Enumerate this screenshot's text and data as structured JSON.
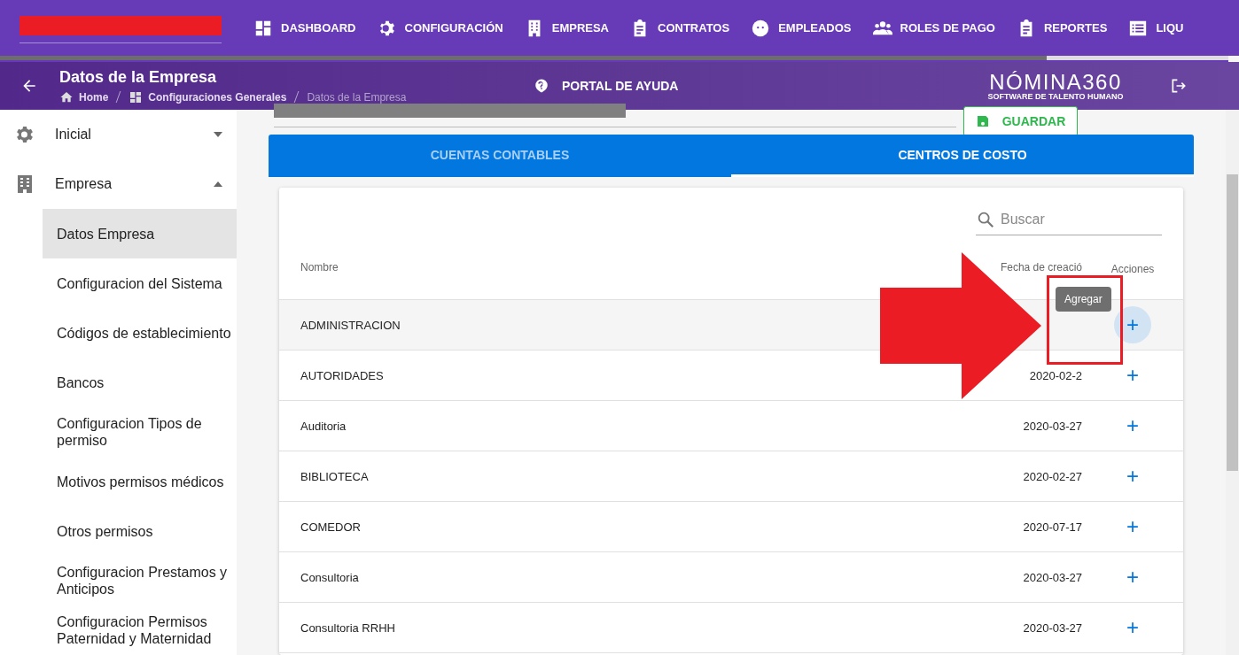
{
  "top_nav": {
    "items": [
      {
        "label": "DASHBOARD",
        "kind": "dashboard"
      },
      {
        "label": "CONFIGURACIÓN",
        "kind": "gear"
      },
      {
        "label": "EMPRESA",
        "kind": "building"
      },
      {
        "label": "CONTRATOS",
        "kind": "clipboard"
      },
      {
        "label": "EMPLEADOS",
        "kind": "face"
      },
      {
        "label": "ROLES DE PAGO",
        "kind": "people"
      },
      {
        "label": "REPORTES",
        "kind": "clipboard"
      },
      {
        "label": "LIQU",
        "kind": "list"
      }
    ]
  },
  "header": {
    "title": "Datos de la Empresa",
    "breadcrumbs": [
      "Home",
      "Configuraciones Generales",
      "Datos de la Empresa"
    ],
    "help": "PORTAL DE AYUDA",
    "logo": {
      "name": "NÓMINA360",
      "tagline": "SOFTWARE DE TALENTO HUMANO"
    }
  },
  "sidebar": {
    "items": [
      {
        "label": "Inicial",
        "kind": "gear",
        "expanded": false
      },
      {
        "label": "Empresa",
        "kind": "building",
        "expanded": true,
        "children": [
          {
            "label": "Datos Empresa",
            "selected": true
          },
          {
            "label": "Configuracion del Sistema",
            "selected": false
          },
          {
            "label": "Códigos de establecimiento",
            "selected": false
          },
          {
            "label": "Bancos",
            "selected": false
          },
          {
            "label": "Configuracion Tipos de permiso",
            "selected": false
          },
          {
            "label": "Motivos permisos médicos",
            "selected": false
          },
          {
            "label": "Otros permisos",
            "selected": false
          },
          {
            "label": "Configuracion Prestamos y Anticipos",
            "selected": false
          },
          {
            "label": "Configuracion Permisos Paternidad y Maternidad",
            "selected": false
          }
        ]
      }
    ]
  },
  "save_button": "GUARDAR",
  "tabs": [
    {
      "label": "CUENTAS CONTABLES",
      "selected": false
    },
    {
      "label": "CENTROS DE COSTO",
      "selected": true
    }
  ],
  "search": {
    "placeholder": "Buscar"
  },
  "table": {
    "columns": [
      "Nombre",
      "Fecha de creació",
      "Acciones"
    ],
    "rows": [
      {
        "name": "ADMINISTRACION",
        "hovered": true
      },
      {
        "name": "AUTORIDADES",
        "date": "2020-02-2",
        "hovered": false
      },
      {
        "name": "Auditoria",
        "date": "2020-03-27",
        "hovered": false
      },
      {
        "name": "BIBLIOTECA",
        "date": "2020-02-27",
        "hovered": false
      },
      {
        "name": "COMEDOR",
        "date": "2020-07-17",
        "hovered": false
      },
      {
        "name": "Consultoria",
        "date": "2020-03-27",
        "hovered": false
      },
      {
        "name": "Consultoria RRHH",
        "date": "2020-03-27",
        "hovered": false
      }
    ],
    "action": "+"
  },
  "tooltip": "Agregar"
}
